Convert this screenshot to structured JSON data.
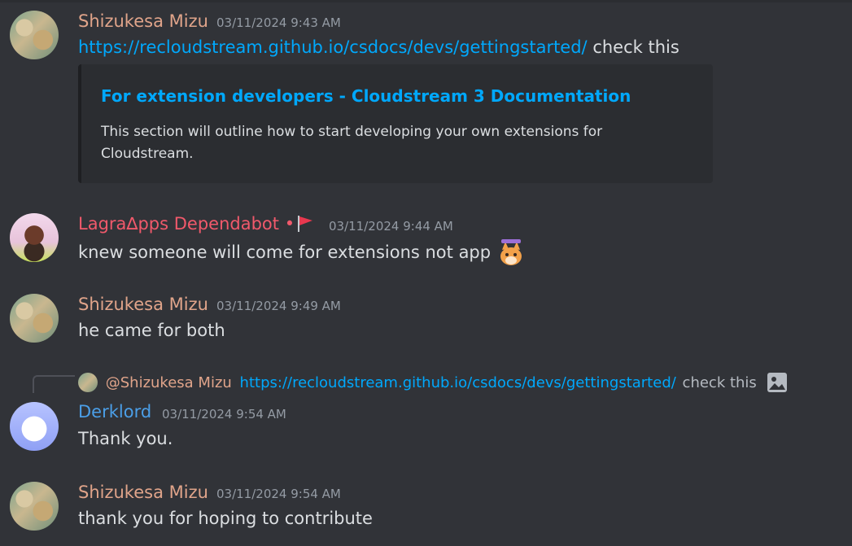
{
  "messages": [
    {
      "author": "Shizukesa Mizu",
      "timestamp": "03/11/2024 9:43 AM",
      "link": "https://recloudstream.github.io/csdocs/devs/gettingstarted/",
      "text": "check this",
      "embed": {
        "title": "For extension developers - Cloudstream 3 Documentation",
        "description": "This section will outline how to start developing your own extensions for Cloudstream."
      }
    },
    {
      "author": "Lagra∆pps Dependabot",
      "separator": "•",
      "timestamp": "03/11/2024 9:44 AM",
      "text": "knew someone will come for extensions not app"
    },
    {
      "author": "Shizukesa Mizu",
      "timestamp": "03/11/2024 9:49 AM",
      "text": "he came for both"
    },
    {
      "reply": {
        "user": "@Shizukesa Mizu",
        "link": "https://recloudstream.github.io/csdocs/devs/gettingstarted/",
        "text": "check this"
      },
      "author": "Derklord",
      "timestamp": "03/11/2024 9:54 AM",
      "text": "Thank you."
    },
    {
      "author": "Shizukesa Mizu",
      "timestamp": "03/11/2024 9:54 AM",
      "text": "thank you for hoping to contribute"
    }
  ],
  "icons": {
    "flag": "red-flag-icon",
    "sticker": "fox-sticker-icon",
    "image": "image-icon"
  },
  "colors": {
    "background": "#313338",
    "link": "#00a8fc",
    "mizu": "#e0a48a",
    "lagra": "#f0596b",
    "derklord": "#4b9fe8"
  }
}
